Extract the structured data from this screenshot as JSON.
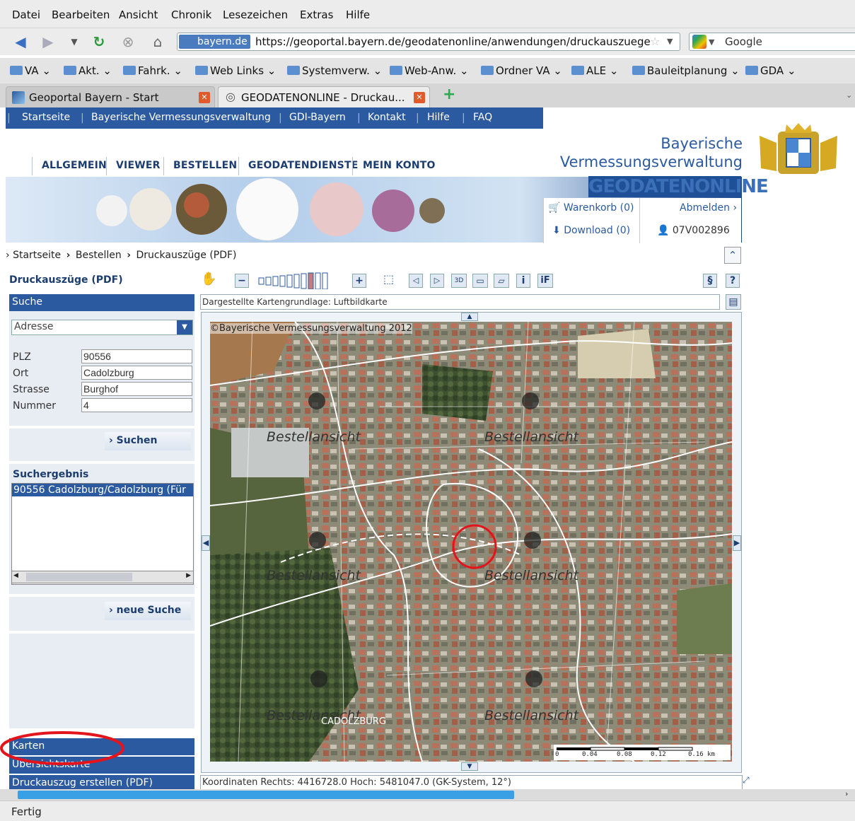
{
  "menu": [
    "Datei",
    "Bearbeiten",
    "Ansicht",
    "Chronik",
    "Lesezeichen",
    "Extras",
    "Hilfe"
  ],
  "url": {
    "site": "bayern.de",
    "address": "https://geoportal.bayern.de/geodatenonline/anwendungen/druckauszuege",
    "search": "Google"
  },
  "bookmarks": [
    "VA",
    "Akt.",
    "Fahrk.",
    "Web Links",
    "Systemverw.",
    "Web-Anw.",
    "Ordner VA",
    "ALE",
    "Bauleitplanung",
    "GDA"
  ],
  "tabs": [
    {
      "label": "Geoportal Bayern - Start"
    },
    {
      "label": "GEODATENONLINE - Druckau..."
    }
  ],
  "topnav": [
    "Startseite",
    "Bayerische Vermessungsverwaltung",
    "GDI-Bayern",
    "Kontakt",
    "Hilfe",
    "FAQ"
  ],
  "org": {
    "line1": "Bayerische",
    "line2": "Vermessungsverwaltung",
    "product": "GEODATENONLINE"
  },
  "mainnav": [
    "ALLGEMEIN",
    "VIEWER",
    "BESTELLEN",
    "GEODATENDIENSTE",
    "MEIN KONTO"
  ],
  "account": {
    "cart": "Warenkorb (0)",
    "logout": "Abmelden",
    "download": "Download (0)",
    "user": "07V002896"
  },
  "breadcrumb": [
    "Startseite",
    "Bestellen",
    "Druckauszüge (PDF)"
  ],
  "left": {
    "title": "Druckauszüge (PDF)",
    "search_header": "Suche",
    "search_type": "Adresse",
    "fields": [
      {
        "label": "PLZ",
        "value": "90556"
      },
      {
        "label": "Ort",
        "value": "Cadolzburg"
      },
      {
        "label": "Strasse",
        "value": "Burghof"
      },
      {
        "label": "Nummer",
        "value": "4"
      }
    ],
    "search_button": "Suchen",
    "result_title": "Suchergebnis",
    "result_item": "90556 Cadolzburg/Cadolzburg (Für",
    "new_search": "neue Suche",
    "bottom_headers": [
      "Karten",
      "Übersichtskarte",
      "Druckauszug erstellen (PDF)"
    ]
  },
  "map": {
    "basemap": "Dargestellte Kartengrundlage: Luftbildkarte",
    "copyright": "©Bayerische Vermessungsverwaltung 2012",
    "order_labels": [
      "Bestellansicht",
      "Bestellansicht",
      "Bestellansicht",
      "Bestellansicht",
      "Bestellansicht",
      "Bestellansicht"
    ],
    "place": "CADOLZBURG",
    "scale": [
      "0",
      "0.04",
      "0.08",
      "0.12",
      "0.16 km"
    ],
    "coords": "Koordinaten Rechts: 4416728.0 Hoch: 5481047.0 (GK-System, 12°)"
  },
  "status": "Fertig"
}
